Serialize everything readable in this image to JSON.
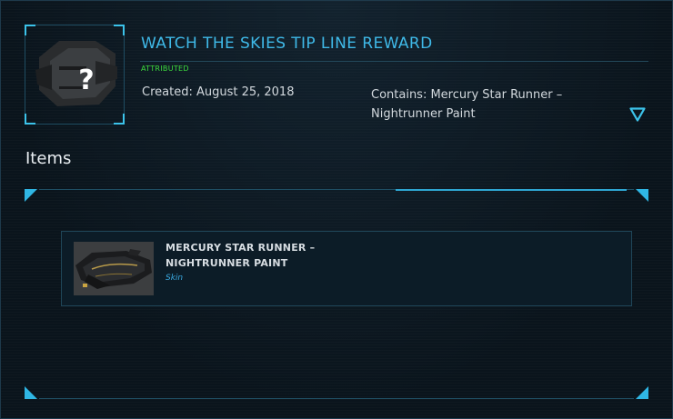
{
  "pledge": {
    "title": "WATCH THE SKIES TIP LINE REWARD",
    "status": "ATTRIBUTED",
    "created": "Created: August 25, 2018",
    "contains": "Contains: Mercury Star Runner – Nightrunner Paint",
    "thumbnail_icon": "unknown-ship-question-icon",
    "expand_icon": "chevron-down-triangle-icon"
  },
  "items_section": {
    "heading": "Items",
    "items": [
      {
        "name": "MERCURY STAR RUNNER – NIGHTRUNNER PAINT",
        "type": "Skin",
        "image_icon": "ship-image"
      }
    ]
  },
  "colors": {
    "accent": "#3fb9e8",
    "status_green": "#3ddc3d",
    "background": "#0b1620"
  }
}
